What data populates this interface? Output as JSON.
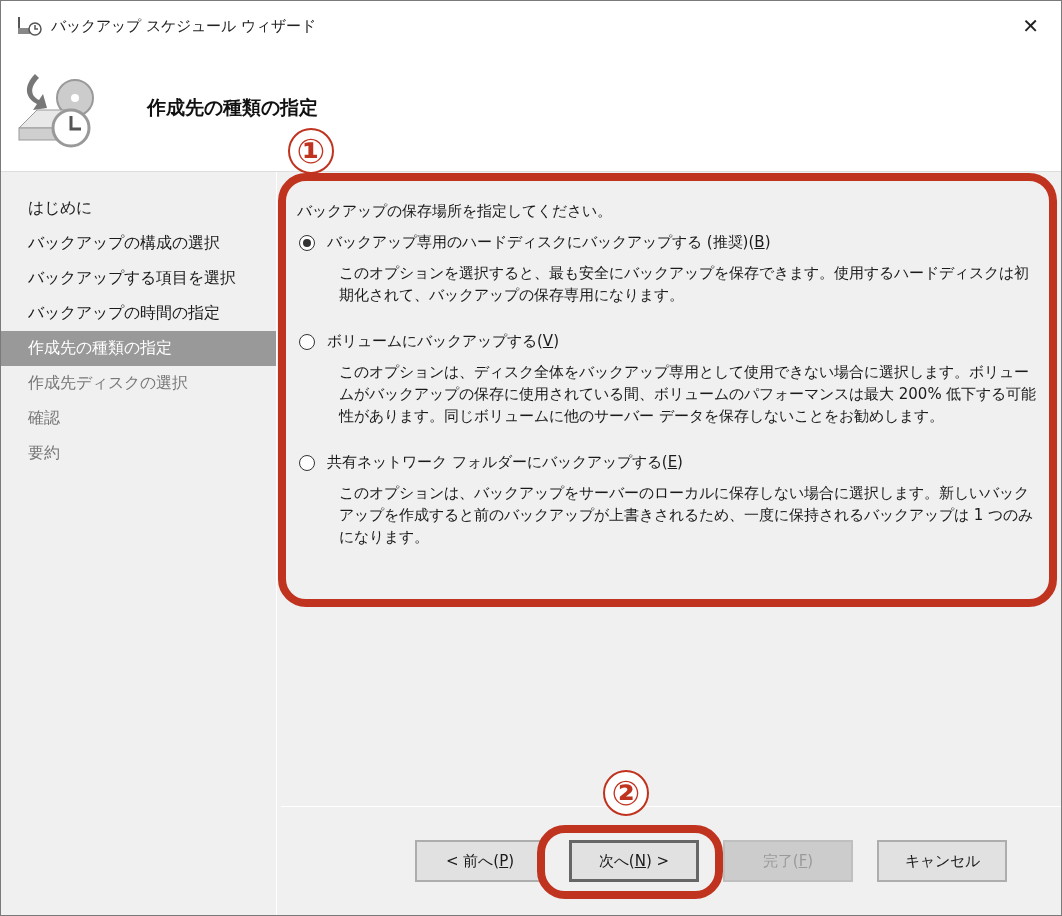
{
  "window": {
    "title": "バックアップ スケジュール ウィザード",
    "close": "✕"
  },
  "header": {
    "title": "作成先の種類の指定"
  },
  "steps": [
    {
      "label": "はじめに",
      "selected": false,
      "disabled": false
    },
    {
      "label": "バックアップの構成の選択",
      "selected": false,
      "disabled": false
    },
    {
      "label": "バックアップする項目を選択",
      "selected": false,
      "disabled": false
    },
    {
      "label": "バックアップの時間の指定",
      "selected": false,
      "disabled": false
    },
    {
      "label": "作成先の種類の指定",
      "selected": true,
      "disabled": false
    },
    {
      "label": "作成先ディスクの選択",
      "selected": false,
      "disabled": true
    },
    {
      "label": "確認",
      "selected": false,
      "disabled": true
    },
    {
      "label": "要約",
      "selected": false,
      "disabled": true
    }
  ],
  "prompt": "バックアップの保存場所を指定してください。",
  "options": [
    {
      "label": "バックアップ専用のハードディスクにバックアップする (推奨)(",
      "access_key": "B",
      "label_end": ")",
      "selected": true,
      "description": "このオプションを選択すると、最も安全にバックアップを保存できます。使用するハードディスクは初期化されて、バックアップの保存専用になります。"
    },
    {
      "label": "ボリュームにバックアップする(",
      "access_key": "V",
      "label_end": ")",
      "selected": false,
      "description": "このオプションは、ディスク全体をバックアップ専用として使用できない場合に選択します。ボリュームがバックアップの保存に使用されている間、ボリュームのパフォーマンスは最大 200% 低下する可能性があります。同じボリュームに他のサーバー データを保存しないことをお勧めします。"
    },
    {
      "label": "共有ネットワーク フォルダーにバックアップする(",
      "access_key": "E",
      "label_end": ")",
      "selected": false,
      "description": "このオプションは、バックアップをサーバーのローカルに保存しない場合に選択します。新しいバックアップを作成すると前のバックアップが上書きされるため、一度に保持されるバックアップは 1 つのみになります。"
    }
  ],
  "buttons": [
    {
      "label": "< 前へ(",
      "access_key": "P",
      "label_end": ")",
      "default": false,
      "disabled": false
    },
    {
      "label": "次へ(",
      "access_key": "N",
      "label_end": ") >",
      "default": true,
      "disabled": false
    },
    {
      "label": "完了(",
      "access_key": "F",
      "label_end": ")",
      "default": false,
      "disabled": true
    },
    {
      "label": "キャンセル",
      "default": false,
      "disabled": false
    }
  ],
  "annotations": [
    {
      "label": "①"
    },
    {
      "label": "②"
    }
  ]
}
